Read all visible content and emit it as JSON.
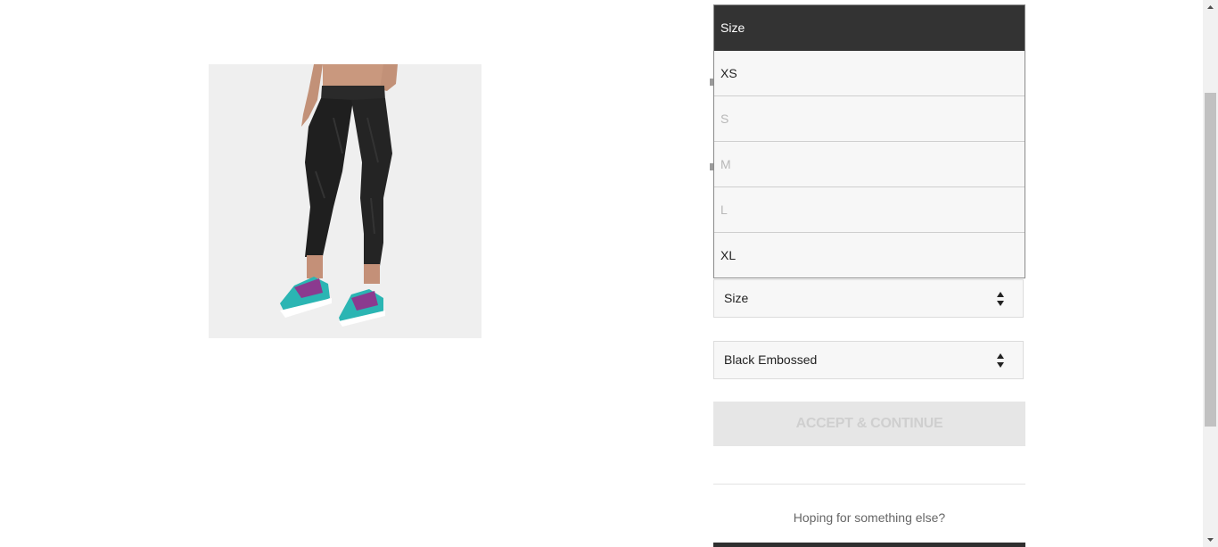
{
  "product": {
    "image_alt": "Women's black embossed cropped running tights"
  },
  "size_dropdown": {
    "options": [
      {
        "label": "Size",
        "state": "header"
      },
      {
        "label": "XS",
        "state": "available"
      },
      {
        "label": "S",
        "state": "disabled"
      },
      {
        "label": "M",
        "state": "disabled"
      },
      {
        "label": "L",
        "state": "disabled"
      },
      {
        "label": "XL",
        "state": "available"
      }
    ]
  },
  "size_select": {
    "value": "Size"
  },
  "color_select": {
    "value": "Black Embossed"
  },
  "accept_button": {
    "label": "ACCEPT & CONTINUE"
  },
  "hoping_text": "Hoping for something else?",
  "colors": {
    "list_header_bg": "#333333",
    "button_disabled_bg": "#e6e6e6",
    "button_disabled_text": "#cfcfcf"
  }
}
